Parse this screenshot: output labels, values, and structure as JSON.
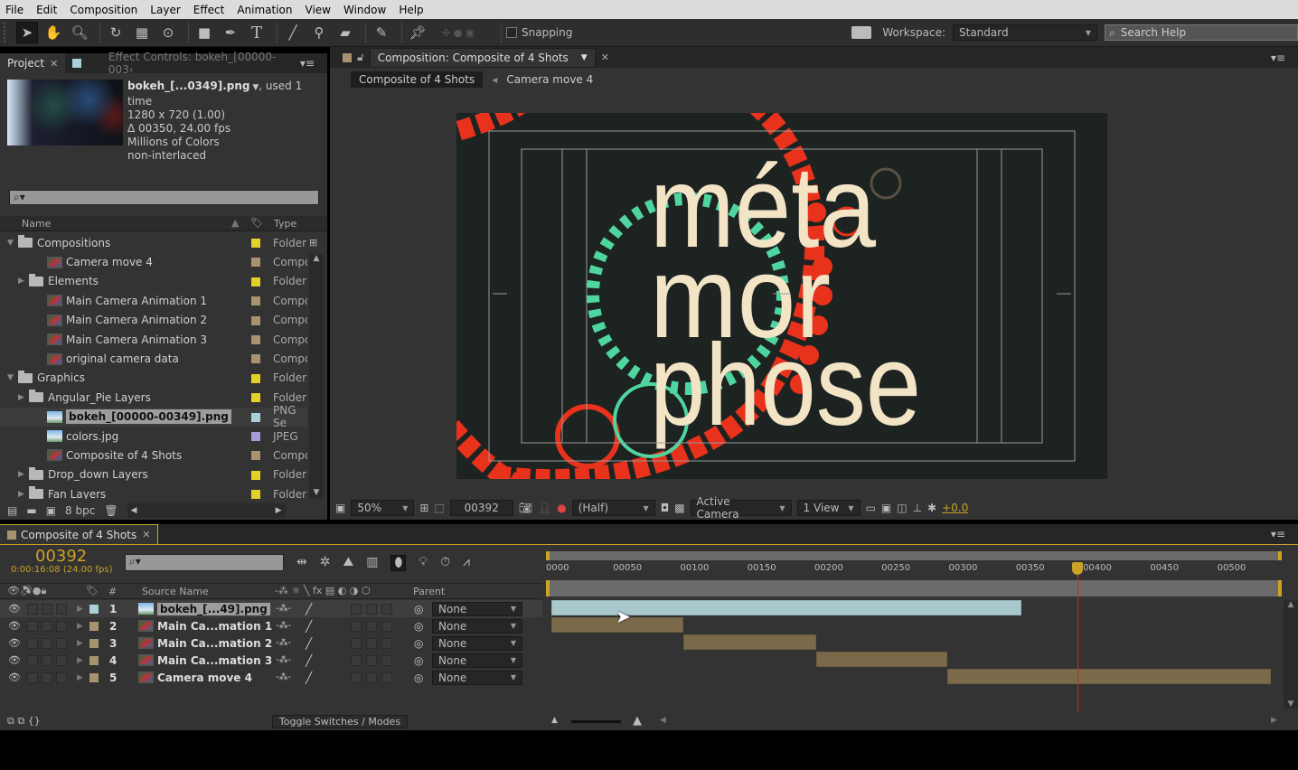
{
  "menu": [
    "File",
    "Edit",
    "Composition",
    "Layer",
    "Effect",
    "Animation",
    "View",
    "Window",
    "Help"
  ],
  "toolbar": {
    "tools": [
      "selection-tool",
      "hand-tool",
      "zoom-tool",
      "rotation-tool",
      "camera-tool",
      "pan-behind-tool",
      "rectangle-tool",
      "pen-tool",
      "text-tool",
      "brush-tool",
      "clone-stamp-tool",
      "eraser-tool",
      "roto-brush-tool",
      "puppet-pin-tool"
    ],
    "snapping": "Snapping",
    "workspace_label": "Workspace:",
    "workspace_value": "Standard",
    "search_placeholder": "Search Help"
  },
  "project": {
    "tab": "Project",
    "effect_tab": "Effect Controls: bokeh_[00000-003‹",
    "selected_name": "bokeh_[...0349].png",
    "used": ", used 1 time",
    "info": [
      "1280 x 720 (1.00)",
      "Δ 00350, 24.00 fps",
      "Millions of Colors",
      "non-interlaced"
    ],
    "col_name": "Name",
    "col_type": "Type",
    "bpc": "8 bpc",
    "items": [
      {
        "name": "Compositions",
        "type": "Folder",
        "kind": "folder",
        "indent": 0,
        "open": true,
        "color": "#e3d12a"
      },
      {
        "name": "Camera move 4",
        "type": "Compo",
        "kind": "comp",
        "indent": 2,
        "color": "#a8936e"
      },
      {
        "name": "Elements",
        "type": "Folder",
        "kind": "folder",
        "indent": 1,
        "closed": true,
        "color": "#e3d12a"
      },
      {
        "name": "Main Camera Animation 1",
        "type": "Compo",
        "kind": "comp",
        "indent": 2,
        "color": "#a8936e"
      },
      {
        "name": "Main Camera Animation 2",
        "type": "Compo",
        "kind": "comp",
        "indent": 2,
        "color": "#a8936e"
      },
      {
        "name": "Main Camera Animation 3",
        "type": "Compo",
        "kind": "comp",
        "indent": 2,
        "color": "#a8936e"
      },
      {
        "name": "original camera data",
        "type": "Compo",
        "kind": "comp",
        "indent": 2,
        "color": "#a8936e"
      },
      {
        "name": "Graphics",
        "type": "Folder",
        "kind": "folder",
        "indent": 0,
        "open": true,
        "color": "#e3d12a"
      },
      {
        "name": "Angular_Pie Layers",
        "type": "Folder",
        "kind": "folder",
        "indent": 1,
        "closed": true,
        "color": "#e3d12a"
      },
      {
        "name": "bokeh_[00000-00349].png",
        "type": "PNG Se",
        "kind": "image",
        "indent": 2,
        "selected": true,
        "color": "#a9d0d8"
      },
      {
        "name": "colors.jpg",
        "type": "JPEG",
        "kind": "image",
        "indent": 2,
        "color": "#a79ad6"
      },
      {
        "name": "Composite of 4 Shots",
        "type": "Compo",
        "kind": "comp",
        "indent": 2,
        "color": "#a8936e"
      },
      {
        "name": "Drop_down Layers",
        "type": "Folder",
        "kind": "folder",
        "indent": 1,
        "closed": true,
        "color": "#e3d12a"
      },
      {
        "name": "Fan Layers",
        "type": "Folder",
        "kind": "folder",
        "indent": 1,
        "closed": true,
        "color": "#e3d12a"
      }
    ]
  },
  "comp": {
    "tab": "Composition: Composite of 4 Shots",
    "crumbs": [
      "Composite of 4 Shots",
      "Camera move 4"
    ],
    "text": [
      "méta",
      "mor",
      "phose"
    ],
    "zoom": "50%",
    "timecode": "00392",
    "resolution": "(Half)",
    "camera": "Active Camera",
    "views": "1 View",
    "exposure": "+0.0"
  },
  "timeline": {
    "tab": "Composite of 4 Shots",
    "current_frame": "00392",
    "timecode": "0:00:16:08 (24.00 fps)",
    "col_source": "Source Name",
    "col_parent": "Parent",
    "toggle": "Toggle Switches / Modes",
    "ruler": [
      "0000",
      "00050",
      "00100",
      "00150",
      "00200",
      "00250",
      "00300",
      "00350",
      "00400",
      "00450",
      "00500"
    ],
    "playhead_frame": 392,
    "frame_max": 540,
    "layers": [
      {
        "num": "1",
        "name": "bokeh_[...49].png",
        "kind": "image",
        "parent": "None",
        "color": "#a9d0d8",
        "start": 0,
        "end": 350,
        "bar": "#a9c8cc",
        "selected": true
      },
      {
        "num": "2",
        "name": "Main Ca...mation 1",
        "kind": "comp",
        "parent": "None",
        "color": "#a8936e",
        "start": 0,
        "end": 98,
        "bar": "#7a6a4a"
      },
      {
        "num": "3",
        "name": "Main Ca...mation 2",
        "kind": "comp",
        "parent": "None",
        "color": "#a8936e",
        "start": 98,
        "end": 197,
        "bar": "#7a6a4a"
      },
      {
        "num": "4",
        "name": "Main Ca...mation 3",
        "kind": "comp",
        "parent": "None",
        "color": "#a8936e",
        "start": 197,
        "end": 295,
        "bar": "#7a6a4a"
      },
      {
        "num": "5",
        "name": "Camera move 4",
        "kind": "comp",
        "parent": "None",
        "color": "#a8936e",
        "start": 295,
        "end": 536,
        "bar": "#7a6a4a"
      }
    ]
  }
}
